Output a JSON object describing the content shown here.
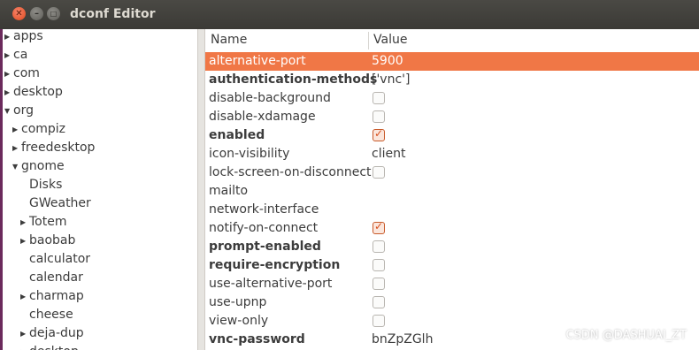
{
  "window": {
    "title": "dconf Editor"
  },
  "tree": [
    {
      "label": "apps",
      "depth": 0,
      "expanded": false,
      "has_children": true
    },
    {
      "label": "ca",
      "depth": 0,
      "expanded": false,
      "has_children": true
    },
    {
      "label": "com",
      "depth": 0,
      "expanded": false,
      "has_children": true
    },
    {
      "label": "desktop",
      "depth": 0,
      "expanded": false,
      "has_children": true
    },
    {
      "label": "org",
      "depth": 0,
      "expanded": true,
      "has_children": true
    },
    {
      "label": "compiz",
      "depth": 1,
      "expanded": false,
      "has_children": true
    },
    {
      "label": "freedesktop",
      "depth": 1,
      "expanded": false,
      "has_children": true
    },
    {
      "label": "gnome",
      "depth": 1,
      "expanded": true,
      "has_children": true
    },
    {
      "label": "Disks",
      "depth": 2,
      "expanded": false,
      "has_children": false
    },
    {
      "label": "GWeather",
      "depth": 2,
      "expanded": false,
      "has_children": false
    },
    {
      "label": "Totem",
      "depth": 2,
      "expanded": false,
      "has_children": true
    },
    {
      "label": "baobab",
      "depth": 2,
      "expanded": false,
      "has_children": true
    },
    {
      "label": "calculator",
      "depth": 2,
      "expanded": false,
      "has_children": false
    },
    {
      "label": "calendar",
      "depth": 2,
      "expanded": false,
      "has_children": false
    },
    {
      "label": "charmap",
      "depth": 2,
      "expanded": false,
      "has_children": true
    },
    {
      "label": "cheese",
      "depth": 2,
      "expanded": false,
      "has_children": false
    },
    {
      "label": "deja-dup",
      "depth": 2,
      "expanded": false,
      "has_children": true
    },
    {
      "label": "desktop",
      "depth": 2,
      "expanded": false,
      "has_children": true
    }
  ],
  "table": {
    "headers": {
      "name": "Name",
      "value": "Value"
    },
    "rows": [
      {
        "name": "alternative-port",
        "bold": false,
        "type": "text",
        "value": "5900",
        "selected": true
      },
      {
        "name": "authentication-methods",
        "bold": true,
        "type": "text",
        "value": "['vnc']",
        "selected": false
      },
      {
        "name": "disable-background",
        "bold": false,
        "type": "bool",
        "checked": false,
        "selected": false
      },
      {
        "name": "disable-xdamage",
        "bold": false,
        "type": "bool",
        "checked": false,
        "selected": false
      },
      {
        "name": "enabled",
        "bold": true,
        "type": "bool",
        "checked": true,
        "selected": false
      },
      {
        "name": "icon-visibility",
        "bold": false,
        "type": "text",
        "value": "client",
        "selected": false
      },
      {
        "name": "lock-screen-on-disconnect",
        "bold": false,
        "type": "bool",
        "checked": false,
        "selected": false
      },
      {
        "name": "mailto",
        "bold": false,
        "type": "text",
        "value": "",
        "selected": false
      },
      {
        "name": "network-interface",
        "bold": false,
        "type": "text",
        "value": "",
        "selected": false
      },
      {
        "name": "notify-on-connect",
        "bold": false,
        "type": "bool",
        "checked": true,
        "selected": false
      },
      {
        "name": "prompt-enabled",
        "bold": true,
        "type": "bool",
        "checked": false,
        "selected": false
      },
      {
        "name": "require-encryption",
        "bold": true,
        "type": "bool",
        "checked": false,
        "selected": false
      },
      {
        "name": "use-alternative-port",
        "bold": false,
        "type": "bool",
        "checked": false,
        "selected": false
      },
      {
        "name": "use-upnp",
        "bold": false,
        "type": "bool",
        "checked": false,
        "selected": false
      },
      {
        "name": "view-only",
        "bold": false,
        "type": "bool",
        "checked": false,
        "selected": false
      },
      {
        "name": "vnc-password",
        "bold": true,
        "type": "text",
        "value": "bnZpZGlh",
        "selected": false
      }
    ]
  },
  "watermark": "CSDN @DASHUAI_ZT",
  "colors": {
    "selection": "#f07746",
    "titlebar": "#3b3a36",
    "close_button": "#e04a1e"
  }
}
